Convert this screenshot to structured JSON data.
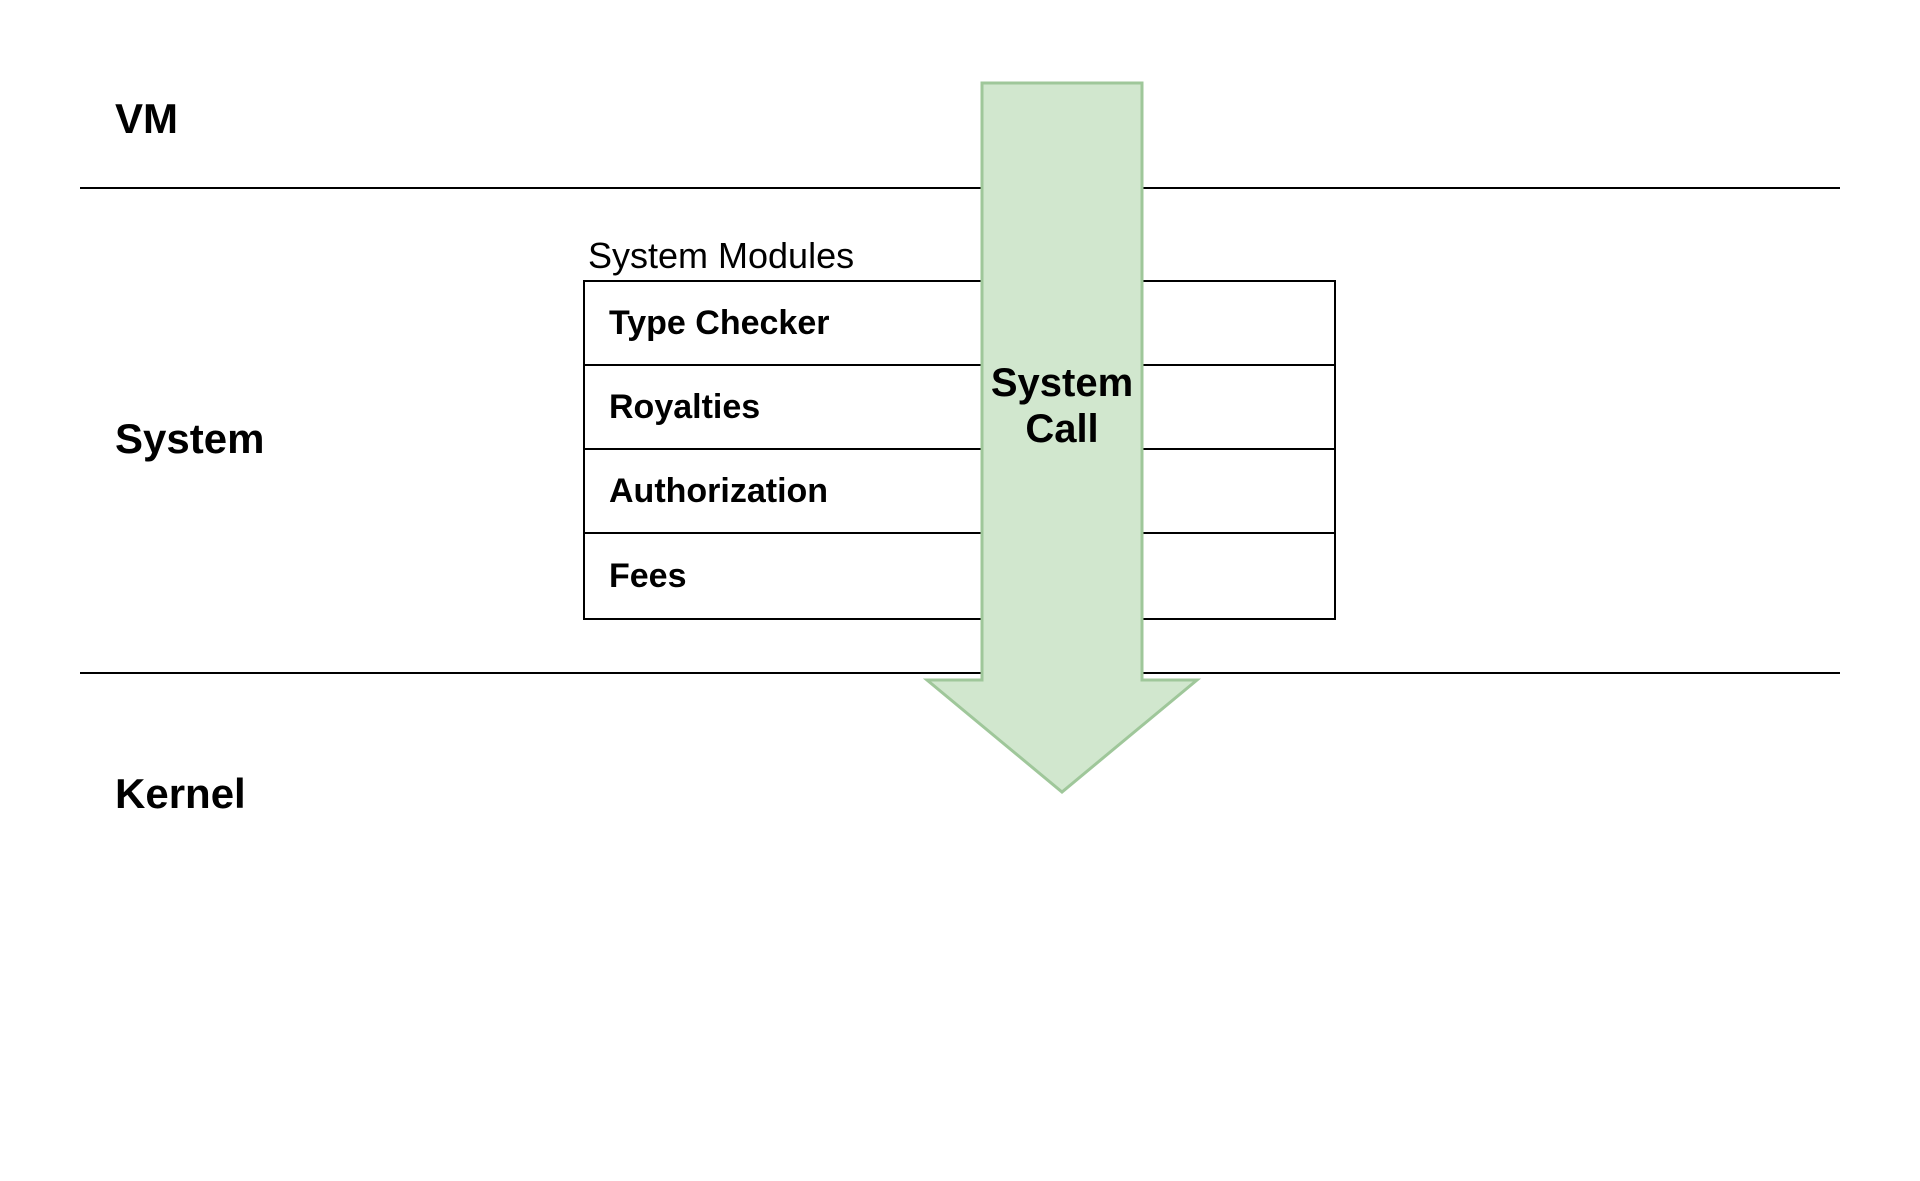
{
  "layers": {
    "vm": "VM",
    "system": "System",
    "kernel": "Kernel"
  },
  "modules": {
    "title": "System Modules",
    "items": [
      "Type Checker",
      "Royalties",
      "Authorization",
      "Fees"
    ]
  },
  "arrow": {
    "label_line1": "System",
    "label_line2": "Call"
  },
  "colors": {
    "arrow_fill": "#d1e7ce",
    "arrow_stroke": "#9fc79a"
  }
}
